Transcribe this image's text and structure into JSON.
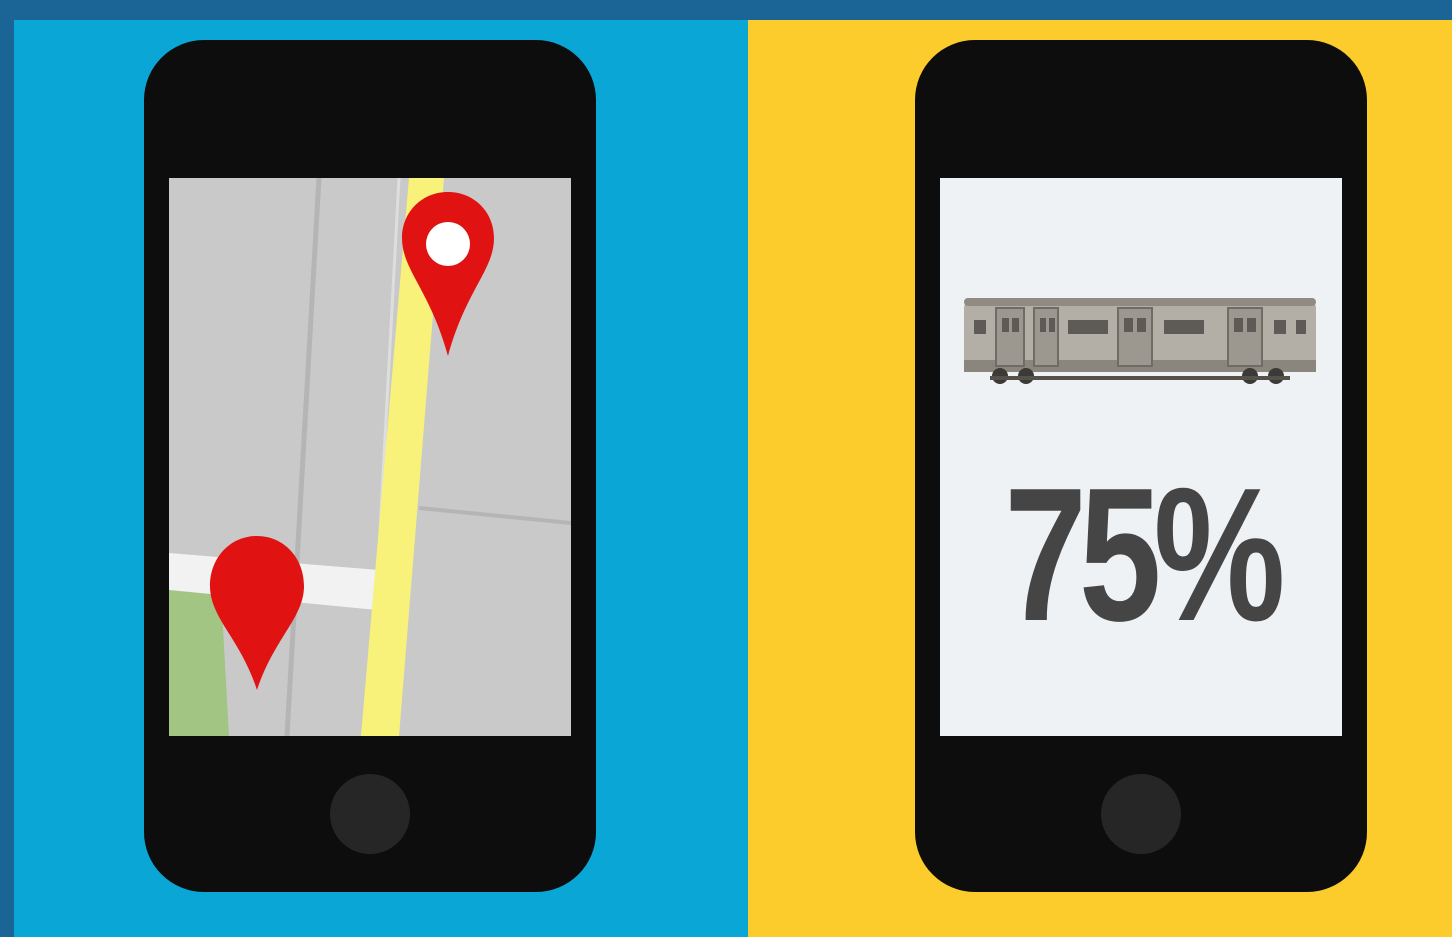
{
  "panels": {
    "left": {
      "background": "#0aa6d6",
      "phone_screen": "map",
      "icons": [
        "map-pin-destination-icon",
        "map-pin-origin-icon"
      ],
      "colors": {
        "route": "#f8f27a",
        "pin": "#e01212",
        "park": "#a3c583",
        "road": "#c9c9c9"
      }
    },
    "right": {
      "background": "#fccb2c",
      "phone_screen": "transit",
      "icons": [
        "subway-train-icon"
      ],
      "stat_value": "75%",
      "colors": {
        "stat_text": "#454545",
        "screen": "#eef2f5"
      }
    }
  },
  "frame_color": "#1b6496",
  "phone_color": "#0d0d0d"
}
